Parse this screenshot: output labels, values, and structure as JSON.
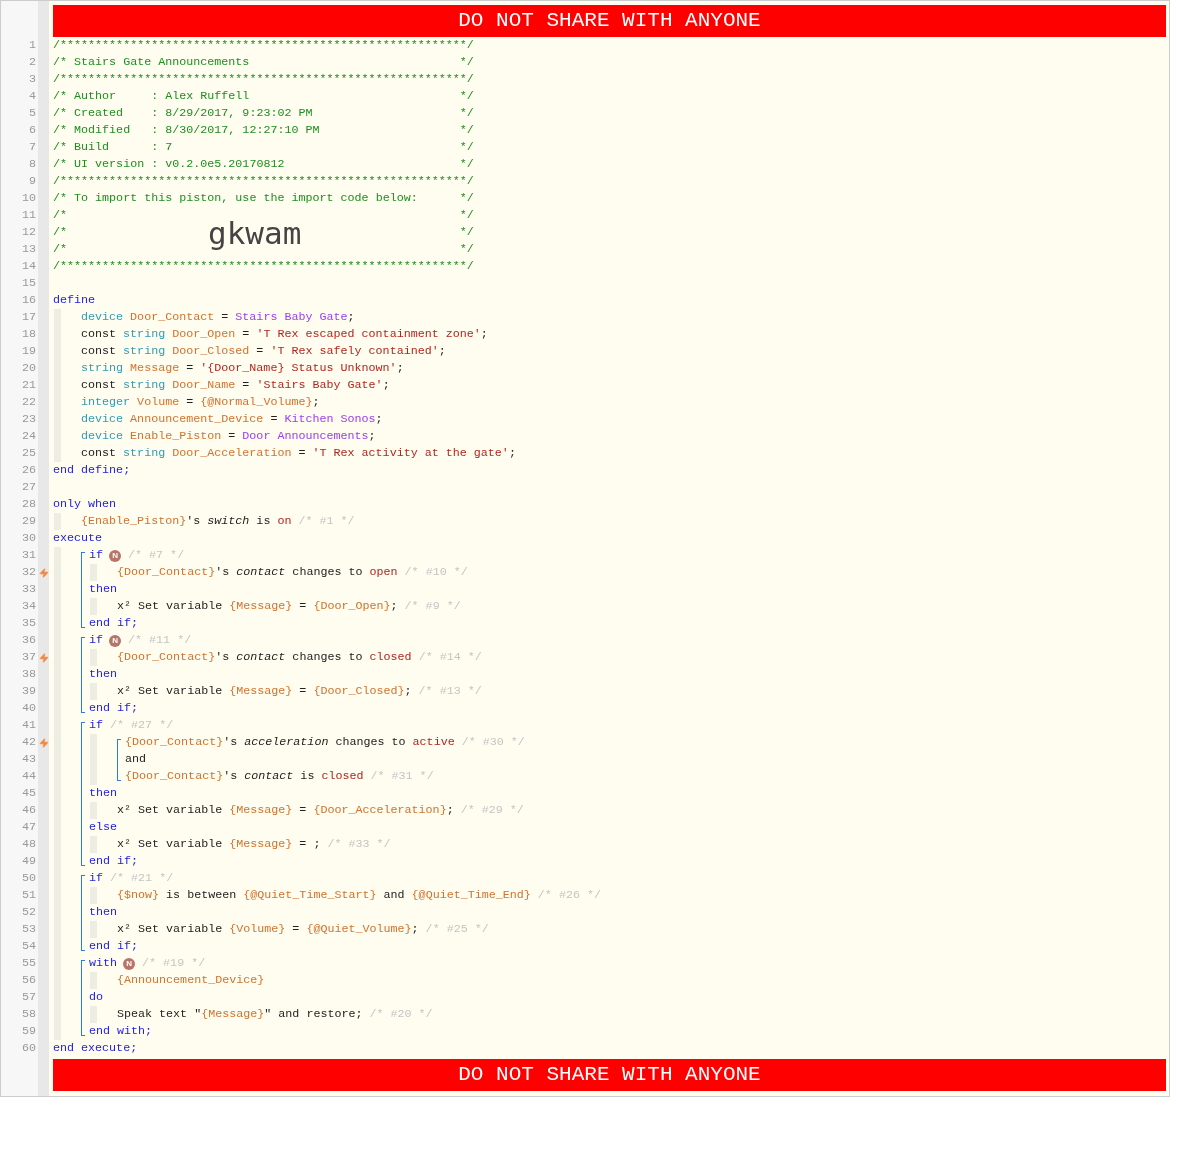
{
  "banner_top": "DO NOT SHARE WITH ANYONE",
  "lines": [
    {
      "kind": "line",
      "number": "1",
      "trigger": false,
      "tokens": [
        {
          "text": "/**********************************************************/",
          "kind": "comment"
        }
      ]
    },
    {
      "kind": "line",
      "number": "2",
      "trigger": false,
      "tokens": [
        {
          "text": "/* Stairs Gate Announcements",
          "kind": "comment"
        },
        {
          "text": "*/",
          "kind": "comment-end"
        }
      ]
    },
    {
      "kind": "line",
      "number": "3",
      "trigger": false,
      "tokens": [
        {
          "text": "/**********************************************************/",
          "kind": "comment"
        }
      ]
    },
    {
      "kind": "line",
      "number": "4",
      "trigger": false,
      "tokens": [
        {
          "text": "/* Author     : Alex Ruffell",
          "kind": "comment"
        },
        {
          "text": "*/",
          "kind": "comment-end"
        }
      ]
    },
    {
      "kind": "line",
      "number": "5",
      "trigger": false,
      "tokens": [
        {
          "text": "/* Created    : 8/29/2017, 9:23:02 PM",
          "kind": "comment"
        },
        {
          "text": "*/",
          "kind": "comment-end"
        }
      ]
    },
    {
      "kind": "line",
      "number": "6",
      "trigger": false,
      "tokens": [
        {
          "text": "/* Modified   : 8/30/2017, 12:27:10 PM",
          "kind": "comment"
        },
        {
          "text": "*/",
          "kind": "comment-end"
        }
      ]
    },
    {
      "kind": "line",
      "number": "7",
      "trigger": false,
      "tokens": [
        {
          "text": "/* Build      : 7",
          "kind": "comment"
        },
        {
          "text": "*/",
          "kind": "comment-end"
        }
      ]
    },
    {
      "kind": "line",
      "number": "8",
      "trigger": false,
      "tokens": [
        {
          "text": "/* UI version : v0.2.0e5.20170812",
          "kind": "comment"
        },
        {
          "text": "*/",
          "kind": "comment-end"
        }
      ]
    },
    {
      "kind": "line",
      "number": "9",
      "trigger": false,
      "tokens": [
        {
          "text": "/**********************************************************/",
          "kind": "comment"
        }
      ]
    },
    {
      "kind": "line",
      "number": "10",
      "trigger": false,
      "tokens": [
        {
          "text": "/* To import this piston, use the import code below:",
          "kind": "comment"
        },
        {
          "text": "*/",
          "kind": "comment-end"
        }
      ]
    },
    {
      "kind": "line",
      "number": "11",
      "trigger": false,
      "tokens": [
        {
          "text": "/*",
          "kind": "comment"
        },
        {
          "text": "*/",
          "kind": "comment-end"
        }
      ]
    },
    {
      "kind": "line",
      "number": "12",
      "trigger": false,
      "tokens": [
        {
          "text": "/*",
          "kind": "comment"
        },
        {
          "text": "gkwam",
          "kind": "import-code"
        },
        {
          "text": "*/",
          "kind": "comment-end"
        }
      ]
    },
    {
      "kind": "line",
      "number": "13",
      "trigger": false,
      "tokens": [
        {
          "text": "/*",
          "kind": "comment"
        },
        {
          "text": "*/",
          "kind": "comment-end"
        }
      ]
    },
    {
      "kind": "line",
      "number": "14",
      "trigger": false,
      "tokens": [
        {
          "text": "/**********************************************************/",
          "kind": "comment"
        }
      ]
    },
    {
      "kind": "line",
      "number": "15",
      "trigger": false
    },
    {
      "kind": "line",
      "number": "16",
      "trigger": false,
      "tokens": [
        {
          "text": "define",
          "kind": "keyword"
        }
      ],
      "children": [
        {
          "kind": "line",
          "number": "17",
          "trigger": false,
          "tokens": [
            {
              "text": "device",
              "kind": "type"
            },
            {
              "text": " Door_Contact",
              "kind": "variable"
            },
            {
              "text": " = ",
              "kind": "plain"
            },
            {
              "text": "Stairs Baby Gate",
              "kind": "device"
            },
            {
              "text": ";",
              "kind": "plain"
            }
          ]
        },
        {
          "kind": "line",
          "number": "18",
          "trigger": false,
          "tokens": [
            {
              "text": "const ",
              "kind": "plain"
            },
            {
              "text": "string",
              "kind": "type"
            },
            {
              "text": " Door_Open",
              "kind": "variable"
            },
            {
              "text": " = ",
              "kind": "plain"
            },
            {
              "text": "'T Rex escaped containment zone'",
              "kind": "string"
            },
            {
              "text": ";",
              "kind": "plain"
            }
          ]
        },
        {
          "kind": "line",
          "number": "19",
          "trigger": false,
          "tokens": [
            {
              "text": "const ",
              "kind": "plain"
            },
            {
              "text": "string",
              "kind": "type"
            },
            {
              "text": " Door_Closed",
              "kind": "variable"
            },
            {
              "text": " = ",
              "kind": "plain"
            },
            {
              "text": "'T Rex safely contained'",
              "kind": "string"
            },
            {
              "text": ";",
              "kind": "plain"
            }
          ]
        },
        {
          "kind": "line",
          "number": "20",
          "trigger": false,
          "tokens": [
            {
              "text": "string",
              "kind": "type"
            },
            {
              "text": " Message",
              "kind": "variable"
            },
            {
              "text": " = ",
              "kind": "plain"
            },
            {
              "text": "'{Door_Name} Status Unknown'",
              "kind": "string"
            },
            {
              "text": ";",
              "kind": "plain"
            }
          ]
        },
        {
          "kind": "line",
          "number": "21",
          "trigger": false,
          "tokens": [
            {
              "text": "const ",
              "kind": "plain"
            },
            {
              "text": "string",
              "kind": "type"
            },
            {
              "text": " Door_Name",
              "kind": "variable"
            },
            {
              "text": " = ",
              "kind": "plain"
            },
            {
              "text": "'Stairs Baby Gate'",
              "kind": "string"
            },
            {
              "text": ";",
              "kind": "plain"
            }
          ]
        },
        {
          "kind": "line",
          "number": "22",
          "trigger": false,
          "tokens": [
            {
              "text": "integer",
              "kind": "type"
            },
            {
              "text": " Volume",
              "kind": "variable"
            },
            {
              "text": " = ",
              "kind": "plain"
            },
            {
              "text": "{@Normal_Volume}",
              "kind": "variable"
            },
            {
              "text": ";",
              "kind": "plain"
            }
          ]
        },
        {
          "kind": "line",
          "number": "23",
          "trigger": false,
          "tokens": [
            {
              "text": "device",
              "kind": "type"
            },
            {
              "text": " Announcement_Device",
              "kind": "variable"
            },
            {
              "text": " = ",
              "kind": "plain"
            },
            {
              "text": "Kitchen Sonos",
              "kind": "device"
            },
            {
              "text": ";",
              "kind": "plain"
            }
          ]
        },
        {
          "kind": "line",
          "number": "24",
          "trigger": false,
          "tokens": [
            {
              "text": "device",
              "kind": "type"
            },
            {
              "text": " Enable_Piston",
              "kind": "variable"
            },
            {
              "text": " = ",
              "kind": "plain"
            },
            {
              "text": "Door Announcements",
              "kind": "device"
            },
            {
              "text": ";",
              "kind": "plain"
            }
          ]
        },
        {
          "kind": "line",
          "number": "25",
          "trigger": false,
          "tokens": [
            {
              "text": "const ",
              "kind": "plain"
            },
            {
              "text": "string",
              "kind": "type"
            },
            {
              "text": " Door_Acceleration",
              "kind": "variable"
            },
            {
              "text": " = ",
              "kind": "plain"
            },
            {
              "text": "'T Rex activity at the gate'",
              "kind": "string"
            },
            {
              "text": ";",
              "kind": "plain"
            }
          ]
        }
      ]
    },
    {
      "kind": "line",
      "number": "26",
      "trigger": false,
      "tokens": [
        {
          "text": "end define;",
          "kind": "keyword"
        }
      ]
    },
    {
      "kind": "line",
      "number": "27",
      "trigger": false
    },
    {
      "kind": "line",
      "number": "28",
      "trigger": false,
      "tokens": [
        {
          "text": "only when",
          "kind": "keyword"
        }
      ],
      "children": [
        {
          "kind": "line",
          "number": "29",
          "trigger": false,
          "tokens": [
            {
              "text": "{Enable_Piston}",
              "kind": "variable"
            },
            {
              "text": "'s ",
              "kind": "plain"
            },
            {
              "text": "switch",
              "kind": "attribute"
            },
            {
              "text": " is ",
              "kind": "plain"
            },
            {
              "text": "on",
              "kind": "string"
            },
            {
              "text": " /* #1 */",
              "kind": "note"
            }
          ]
        }
      ]
    },
    {
      "kind": "line",
      "number": "30",
      "trigger": false,
      "tokens": [
        {
          "text": "execute",
          "kind": "keyword"
        }
      ],
      "children": [
        {
          "kind": "block",
          "lines": [
            {
              "kind": "line",
              "number": "31",
              "trigger": false,
              "tokens": [
                {
                  "text": "if",
                  "kind": "keyword"
                },
                {
                  "text": "N",
                  "kind": "badge"
                },
                {
                  "text": "/* #7 */",
                  "kind": "note"
                }
              ],
              "children": [
                {
                  "kind": "line",
                  "number": "32",
                  "trigger": true,
                  "tokens": [
                    {
                      "text": "{Door_Contact}",
                      "kind": "variable"
                    },
                    {
                      "text": "'s ",
                      "kind": "plain"
                    },
                    {
                      "text": "contact",
                      "kind": "attribute"
                    },
                    {
                      "text": " changes to ",
                      "kind": "plain"
                    },
                    {
                      "text": "open",
                      "kind": "string"
                    },
                    {
                      "text": " /* #10 */",
                      "kind": "note"
                    }
                  ]
                }
              ]
            },
            {
              "kind": "line",
              "number": "33",
              "trigger": false,
              "tokens": [
                {
                  "text": "then",
                  "kind": "keyword"
                }
              ],
              "children": [
                {
                  "kind": "line",
                  "number": "34",
                  "trigger": false,
                  "tokens": [
                    {
                      "text": "x² Set variable ",
                      "kind": "plain"
                    },
                    {
                      "text": "{Message}",
                      "kind": "variable"
                    },
                    {
                      "text": " = ",
                      "kind": "plain"
                    },
                    {
                      "text": "{Door_Open}",
                      "kind": "variable"
                    },
                    {
                      "text": ";",
                      "kind": "plain"
                    },
                    {
                      "text": " /* #9 */",
                      "kind": "note"
                    }
                  ]
                }
              ]
            },
            {
              "kind": "line",
              "number": "35",
              "trigger": false,
              "tokens": [
                {
                  "text": "end if;",
                  "kind": "keyword"
                }
              ]
            }
          ]
        },
        {
          "kind": "block",
          "lines": [
            {
              "kind": "line",
              "number": "36",
              "trigger": false,
              "tokens": [
                {
                  "text": "if",
                  "kind": "keyword"
                },
                {
                  "text": "N",
                  "kind": "badge"
                },
                {
                  "text": "/* #11 */",
                  "kind": "note"
                }
              ],
              "children": [
                {
                  "kind": "line",
                  "number": "37",
                  "trigger": true,
                  "tokens": [
                    {
                      "text": "{Door_Contact}",
                      "kind": "variable"
                    },
                    {
                      "text": "'s ",
                      "kind": "plain"
                    },
                    {
                      "text": "contact",
                      "kind": "attribute"
                    },
                    {
                      "text": " changes to ",
                      "kind": "plain"
                    },
                    {
                      "text": "closed",
                      "kind": "string"
                    },
                    {
                      "text": " /* #14 */",
                      "kind": "note"
                    }
                  ]
                }
              ]
            },
            {
              "kind": "line",
              "number": "38",
              "trigger": false,
              "tokens": [
                {
                  "text": "then",
                  "kind": "keyword"
                }
              ],
              "children": [
                {
                  "kind": "line",
                  "number": "39",
                  "trigger": false,
                  "tokens": [
                    {
                      "text": "x² Set variable ",
                      "kind": "plain"
                    },
                    {
                      "text": "{Message}",
                      "kind": "variable"
                    },
                    {
                      "text": " = ",
                      "kind": "plain"
                    },
                    {
                      "text": "{Door_Closed}",
                      "kind": "variable"
                    },
                    {
                      "text": ";",
                      "kind": "plain"
                    },
                    {
                      "text": " /* #13 */",
                      "kind": "note"
                    }
                  ]
                }
              ]
            },
            {
              "kind": "line",
              "number": "40",
              "trigger": false,
              "tokens": [
                {
                  "text": "end if;",
                  "kind": "keyword"
                }
              ]
            }
          ]
        },
        {
          "kind": "block",
          "lines": [
            {
              "kind": "line",
              "number": "41",
              "trigger": false,
              "tokens": [
                {
                  "text": "if",
                  "kind": "keyword"
                },
                {
                  "text": " /* #27 */",
                  "kind": "note"
                }
              ],
              "children": [
                {
                  "kind": "block",
                  "lines": [
                    {
                      "kind": "line",
                      "number": "42",
                      "trigger": true,
                      "tokens": [
                        {
                          "text": "{Door_Contact}",
                          "kind": "variable"
                        },
                        {
                          "text": "'s ",
                          "kind": "plain"
                        },
                        {
                          "text": "acceleration",
                          "kind": "attribute"
                        },
                        {
                          "text": " changes to ",
                          "kind": "plain"
                        },
                        {
                          "text": "active",
                          "kind": "string"
                        },
                        {
                          "text": " /* #30 */",
                          "kind": "note"
                        }
                      ]
                    },
                    {
                      "kind": "line",
                      "number": "43",
                      "trigger": false,
                      "tokens": [
                        {
                          "text": "and",
                          "kind": "plain"
                        }
                      ]
                    },
                    {
                      "kind": "line",
                      "number": "44",
                      "trigger": false,
                      "tokens": [
                        {
                          "text": "{Door_Contact}",
                          "kind": "variable"
                        },
                        {
                          "text": "'s ",
                          "kind": "plain"
                        },
                        {
                          "text": "contact",
                          "kind": "attribute"
                        },
                        {
                          "text": " is ",
                          "kind": "plain"
                        },
                        {
                          "text": "closed",
                          "kind": "string"
                        },
                        {
                          "text": " /* #31 */",
                          "kind": "note"
                        }
                      ]
                    }
                  ]
                }
              ]
            },
            {
              "kind": "line",
              "number": "45",
              "trigger": false,
              "tokens": [
                {
                  "text": "then",
                  "kind": "keyword"
                }
              ],
              "children": [
                {
                  "kind": "line",
                  "number": "46",
                  "trigger": false,
                  "tokens": [
                    {
                      "text": "x² Set variable ",
                      "kind": "plain"
                    },
                    {
                      "text": "{Message}",
                      "kind": "variable"
                    },
                    {
                      "text": " = ",
                      "kind": "plain"
                    },
                    {
                      "text": "{Door_Acceleration}",
                      "kind": "variable"
                    },
                    {
                      "text": ";",
                      "kind": "plain"
                    },
                    {
                      "text": " /* #29 */",
                      "kind": "note"
                    }
                  ]
                }
              ]
            },
            {
              "kind": "line",
              "number": "47",
              "trigger": false,
              "tokens": [
                {
                  "text": "else",
                  "kind": "keyword"
                }
              ],
              "children": [
                {
                  "kind": "line",
                  "number": "48",
                  "trigger": false,
                  "tokens": [
                    {
                      "text": "x² Set variable ",
                      "kind": "plain"
                    },
                    {
                      "text": "{Message}",
                      "kind": "variable"
                    },
                    {
                      "text": " = ;",
                      "kind": "plain"
                    },
                    {
                      "text": " /* #33 */",
                      "kind": "note"
                    }
                  ]
                }
              ]
            },
            {
              "kind": "line",
              "number": "49",
              "trigger": false,
              "tokens": [
                {
                  "text": "end if;",
                  "kind": "keyword"
                }
              ]
            }
          ]
        },
        {
          "kind": "block",
          "lines": [
            {
              "kind": "line",
              "number": "50",
              "trigger": false,
              "tokens": [
                {
                  "text": "if",
                  "kind": "keyword"
                },
                {
                  "text": " /* #21 */",
                  "kind": "note"
                }
              ],
              "children": [
                {
                  "kind": "line",
                  "number": "51",
                  "trigger": false,
                  "tokens": [
                    {
                      "text": "{$now}",
                      "kind": "variable"
                    },
                    {
                      "text": " is between ",
                      "kind": "plain"
                    },
                    {
                      "text": "{@Quiet_Time_Start}",
                      "kind": "variable"
                    },
                    {
                      "text": " and ",
                      "kind": "plain"
                    },
                    {
                      "text": "{@Quiet_Time_End}",
                      "kind": "variable"
                    },
                    {
                      "text": " /* #26 */",
                      "kind": "note"
                    }
                  ]
                }
              ]
            },
            {
              "kind": "line",
              "number": "52",
              "trigger": false,
              "tokens": [
                {
                  "text": "then",
                  "kind": "keyword"
                }
              ],
              "children": [
                {
                  "kind": "line",
                  "number": "53",
                  "trigger": false,
                  "tokens": [
                    {
                      "text": "x² Set variable ",
                      "kind": "plain"
                    },
                    {
                      "text": "{Volume}",
                      "kind": "variable"
                    },
                    {
                      "text": " = ",
                      "kind": "plain"
                    },
                    {
                      "text": "{@Quiet_Volume}",
                      "kind": "variable"
                    },
                    {
                      "text": ";",
                      "kind": "plain"
                    },
                    {
                      "text": " /* #25 */",
                      "kind": "note"
                    }
                  ]
                }
              ]
            },
            {
              "kind": "line",
              "number": "54",
              "trigger": false,
              "tokens": [
                {
                  "text": "end if;",
                  "kind": "keyword"
                }
              ]
            }
          ]
        },
        {
          "kind": "block",
          "lines": [
            {
              "kind": "line",
              "number": "55",
              "trigger": false,
              "tokens": [
                {
                  "text": "with",
                  "kind": "keyword"
                },
                {
                  "text": "N",
                  "kind": "badge"
                },
                {
                  "text": "/* #19 */",
                  "kind": "note"
                }
              ],
              "children": [
                {
                  "kind": "line",
                  "number": "56",
                  "trigger": false,
                  "tokens": [
                    {
                      "text": "{Announcement_Device}",
                      "kind": "variable"
                    }
                  ]
                }
              ]
            },
            {
              "kind": "line",
              "number": "57",
              "trigger": false,
              "tokens": [
                {
                  "text": "do",
                  "kind": "keyword"
                }
              ],
              "children": [
                {
                  "kind": "line",
                  "number": "58",
                  "trigger": false,
                  "tokens": [
                    {
                      "text": "Speak text \"",
                      "kind": "plain"
                    },
                    {
                      "text": "{Message}",
                      "kind": "variable"
                    },
                    {
                      "text": "\" and restore;",
                      "kind": "plain"
                    },
                    {
                      "text": " /* #20 */",
                      "kind": "note"
                    }
                  ]
                }
              ]
            },
            {
              "kind": "line",
              "number": "59",
              "trigger": false,
              "tokens": [
                {
                  "text": "end with;",
                  "kind": "keyword"
                }
              ]
            }
          ]
        }
      ]
    },
    {
      "kind": "line",
      "number": "60",
      "trigger": false,
      "tokens": [
        {
          "text": "end execute;",
          "kind": "keyword"
        }
      ]
    }
  ],
  "banner_bottom": "DO NOT SHARE WITH ANYONE"
}
